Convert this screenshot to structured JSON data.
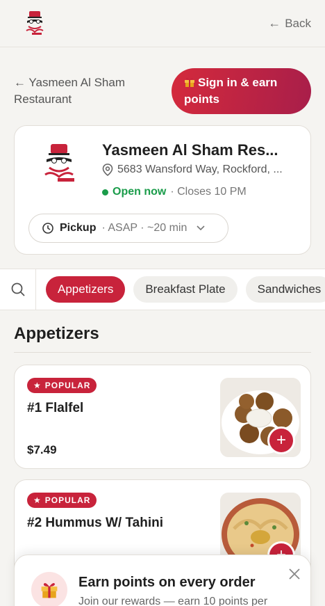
{
  "header": {
    "back_label": "Back",
    "back_arrow": "←"
  },
  "nav": {
    "restaurant_back_line1": "← Yasmeen Al Sham",
    "restaurant_back_line2": "Restaurant",
    "signin_icon": "gift-icon",
    "signin_label": "Sign in & earn points"
  },
  "restaurant": {
    "name": "Yasmeen Al Sham Res...",
    "address": "5683 Wansford Way, Rockford, ...",
    "status_open": "Open now",
    "status_closes": "· Closes 10 PM",
    "order_mode": "Pickup",
    "order_time": "· ASAP · ~20 min"
  },
  "categories": [
    {
      "label": "Appetizers",
      "active": true
    },
    {
      "label": "Breakfast Plate",
      "active": false
    },
    {
      "label": "Sandwiches",
      "active": false
    }
  ],
  "section": {
    "title": "Appetizers"
  },
  "items": [
    {
      "badge": "POPULAR",
      "name": "#1 Flalfel",
      "price": "$7.49"
    },
    {
      "badge": "POPULAR",
      "name": "#2 Hummus W/ Tahini",
      "price": ""
    }
  ],
  "promo": {
    "title": "Earn points on every order",
    "subtitle": "Join our rewards — earn 10 points per"
  },
  "colors": {
    "brand_red": "#c8233b",
    "open_green": "#1a9c4a"
  }
}
